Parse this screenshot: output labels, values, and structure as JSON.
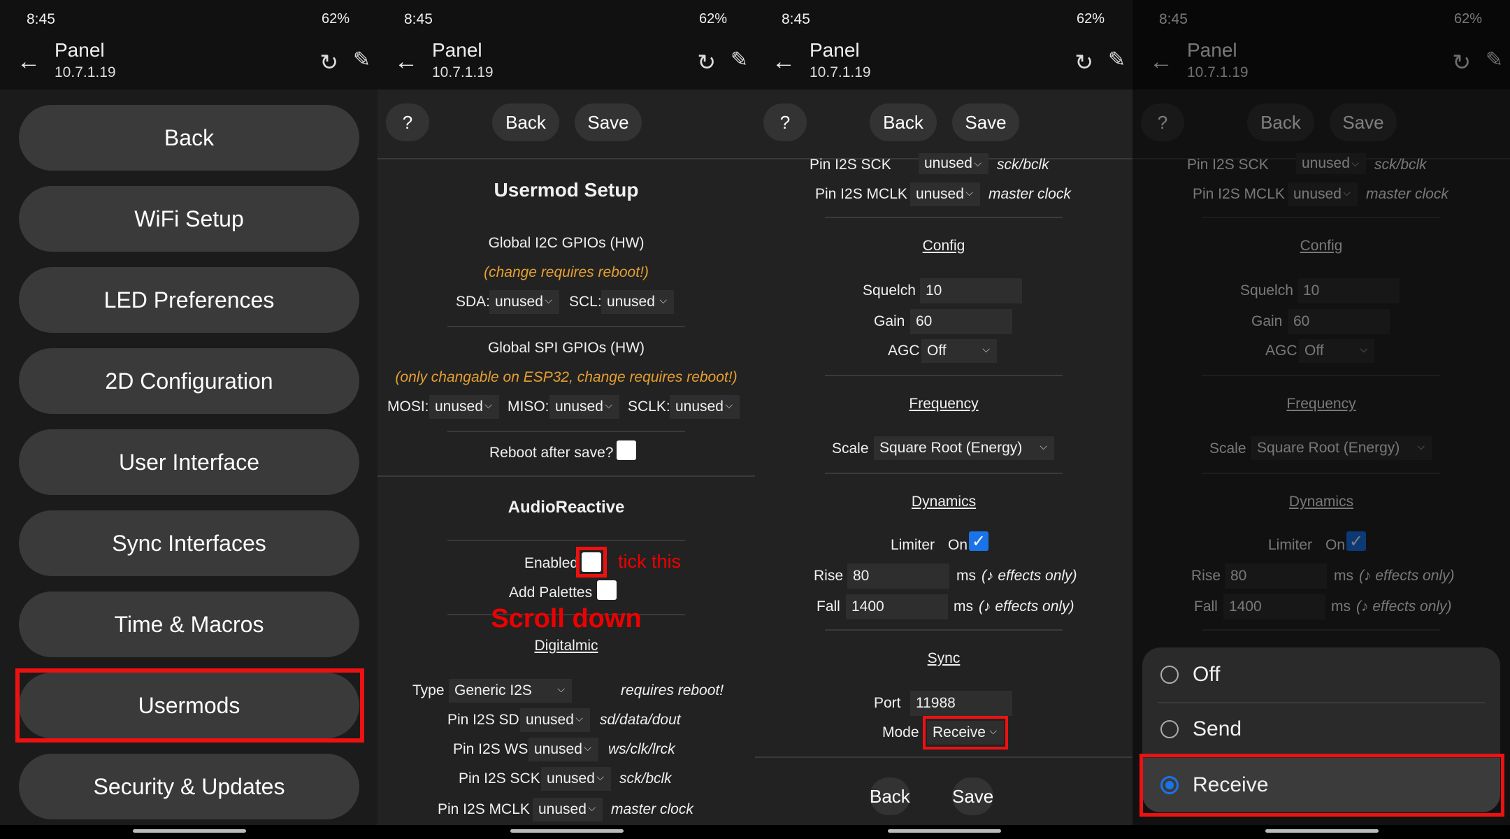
{
  "status": {
    "time": "8:45",
    "battery": "62%"
  },
  "appbar": {
    "title": "Panel",
    "subtitle": "10.7.1.19",
    "back_icon": "arrow-left-icon",
    "reload_icon": "reload-icon",
    "edit_icon": "pencil-icon"
  },
  "panel1": {
    "menu": [
      "Back",
      "WiFi Setup",
      "LED Preferences",
      "2D Configuration",
      "User Interface",
      "Sync Interfaces",
      "Time & Macros",
      "Usermods",
      "Security & Updates"
    ]
  },
  "toolbar": {
    "help": "?",
    "back": "Back",
    "save": "Save"
  },
  "panel2": {
    "title": "Usermod Setup",
    "i2c_title": "Global I2C GPIOs (HW)",
    "i2c_note": "(change requires reboot!)",
    "sda_label": "SDA:",
    "scl_label": "SCL:",
    "unused": "unused",
    "spi_title": "Global SPI GPIOs (HW)",
    "spi_note": "(only changable on ESP32, change requires reboot!)",
    "mosi_label": "MOSI:",
    "miso_label": "MISO:",
    "sclk_label": "SCLK:",
    "reboot_label": "Reboot after save?",
    "audio_title": "AudioReactive",
    "enabled_label": "Enabled",
    "tick_note": "tick this",
    "palettes_label": "Add Palettes",
    "scroll_note": "Scroll down",
    "digitalmic": "Digitalmic",
    "type_label": "Type",
    "type_value": "Generic I2S",
    "type_note": "requires reboot!",
    "sd_label": "Pin I2S SD",
    "sd_note": "sd/data/dout",
    "ws_label": "Pin I2S WS",
    "ws_note": "ws/clk/lrck",
    "sck_label": "Pin I2S SCK",
    "sck_note": "sck/bclk",
    "mclk_label": "Pin I2S MCLK",
    "mclk_note": "master clock"
  },
  "panel3": {
    "config": "Config",
    "squelch_label": "Squelch",
    "squelch_value": "10",
    "gain_label": "Gain",
    "gain_value": "60",
    "agc_label": "AGC",
    "agc_value": "Off",
    "frequency": "Frequency",
    "scale_label": "Scale",
    "scale_value": "Square Root (Energy)",
    "dynamics": "Dynamics",
    "limiter_label": "Limiter",
    "limiter_on": "On",
    "rise_label": "Rise",
    "rise_value": "80",
    "fall_label": "Fall",
    "fall_value": "1400",
    "ms_note": "ms",
    "effects_note": "(♪ effects only)",
    "sync": "Sync",
    "port_label": "Port",
    "port_value": "11988",
    "mode_label": "Mode",
    "mode_value": "Receive"
  },
  "panel4": {
    "options": [
      "Off",
      "Send",
      "Receive"
    ],
    "selected": "Receive"
  }
}
